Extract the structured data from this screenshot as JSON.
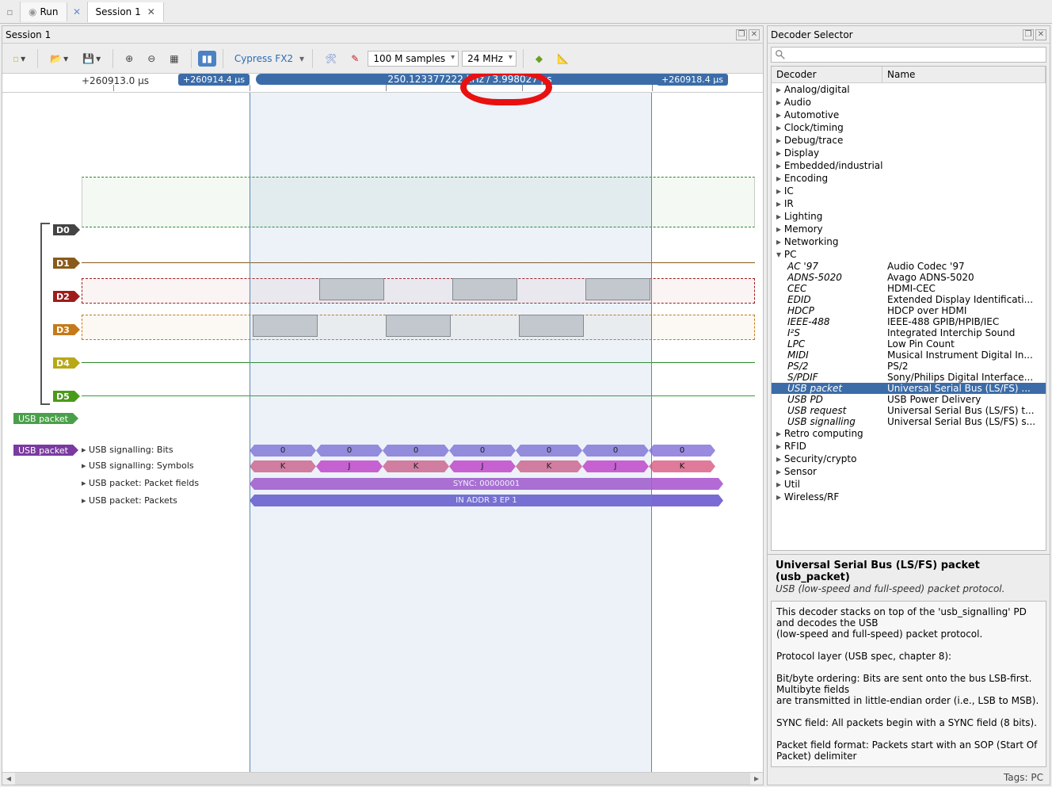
{
  "tabs": {
    "run": "Run",
    "session": "Session 1"
  },
  "session_title": "Session 1",
  "decoder_selector_title": "Decoder Selector",
  "toolbar": {
    "device": "Cypress FX2",
    "samples": "100 M samples",
    "rate": "24 MHz"
  },
  "ruler": {
    "t0": "+260913.0 µs",
    "cursor_left": "+260914.4 µs",
    "cursor_right": "+260918.4 µs",
    "band_freq": "250.123377222 kHz",
    "band_dur": "3.998027 µs"
  },
  "channels": {
    "d0": "D0",
    "d1": "D1",
    "d2": "D2",
    "d3": "D3",
    "d4": "D4",
    "d5": "D5"
  },
  "dec_labels": {
    "usb_packet": "USB packet"
  },
  "dec_rows": {
    "bits": "USB signalling: Bits",
    "symbols": "USB signalling: Symbols",
    "fields": "USB packet: Packet fields",
    "packets": "USB packet: Packets"
  },
  "dec_vals": {
    "bit": "0",
    "k": "K",
    "j": "J",
    "sync": "SYNC: 00000001",
    "in": "IN ADDR 3 EP 1"
  },
  "selector": {
    "col_decoder": "Decoder",
    "col_name": "Name",
    "cats": [
      "Analog/digital",
      "Audio",
      "Automotive",
      "Clock/timing",
      "Debug/trace",
      "Display",
      "Embedded/industrial",
      "Encoding",
      "IC",
      "IR",
      "Lighting",
      "Memory",
      "Networking",
      "PC",
      "Retro computing",
      "RFID",
      "Security/crypto",
      "Sensor",
      "Util",
      "Wireless/RF"
    ],
    "pc_items": [
      {
        "d": "AC '97",
        "n": "Audio Codec '97"
      },
      {
        "d": "ADNS-5020",
        "n": "Avago ADNS-5020"
      },
      {
        "d": "CEC",
        "n": "HDMI-CEC"
      },
      {
        "d": "EDID",
        "n": "Extended Display Identificati..."
      },
      {
        "d": "HDCP",
        "n": "HDCP over HDMI"
      },
      {
        "d": "IEEE-488",
        "n": "IEEE-488 GPIB/HPIB/IEC"
      },
      {
        "d": "I²S",
        "n": "Integrated Interchip Sound"
      },
      {
        "d": "LPC",
        "n": "Low Pin Count"
      },
      {
        "d": "MIDI",
        "n": "Musical Instrument Digital In..."
      },
      {
        "d": "PS/2",
        "n": "PS/2"
      },
      {
        "d": "S/PDIF",
        "n": "Sony/Philips Digital Interface..."
      },
      {
        "d": "USB packet",
        "n": "Universal Serial Bus (LS/FS) ..."
      },
      {
        "d": "USB PD",
        "n": "USB Power Delivery"
      },
      {
        "d": "USB request",
        "n": "Universal Serial Bus (LS/FS) t..."
      },
      {
        "d": "USB signalling",
        "n": "Universal Serial Bus (LS/FS) s..."
      }
    ],
    "detail_title": "Universal Serial Bus (LS/FS) packet (usb_packet)",
    "detail_sub": "USB (low-speed and full-speed) packet protocol.",
    "detail_body": "This decoder stacks on top of the 'usb_signalling' PD and decodes the USB\n(low-speed and full-speed) packet protocol.\n\nProtocol layer (USB spec, chapter 8):\n\nBit/byte ordering: Bits are sent onto the bus LSB-first. Multibyte fields\nare transmitted in little-endian order (i.e., LSB to MSB).\n\nSYNC field: All packets begin with a SYNC field (8 bits).\n\nPacket field format: Packets start with an SOP (Start Of Packet) delimiter",
    "tags": "Tags: PC"
  }
}
